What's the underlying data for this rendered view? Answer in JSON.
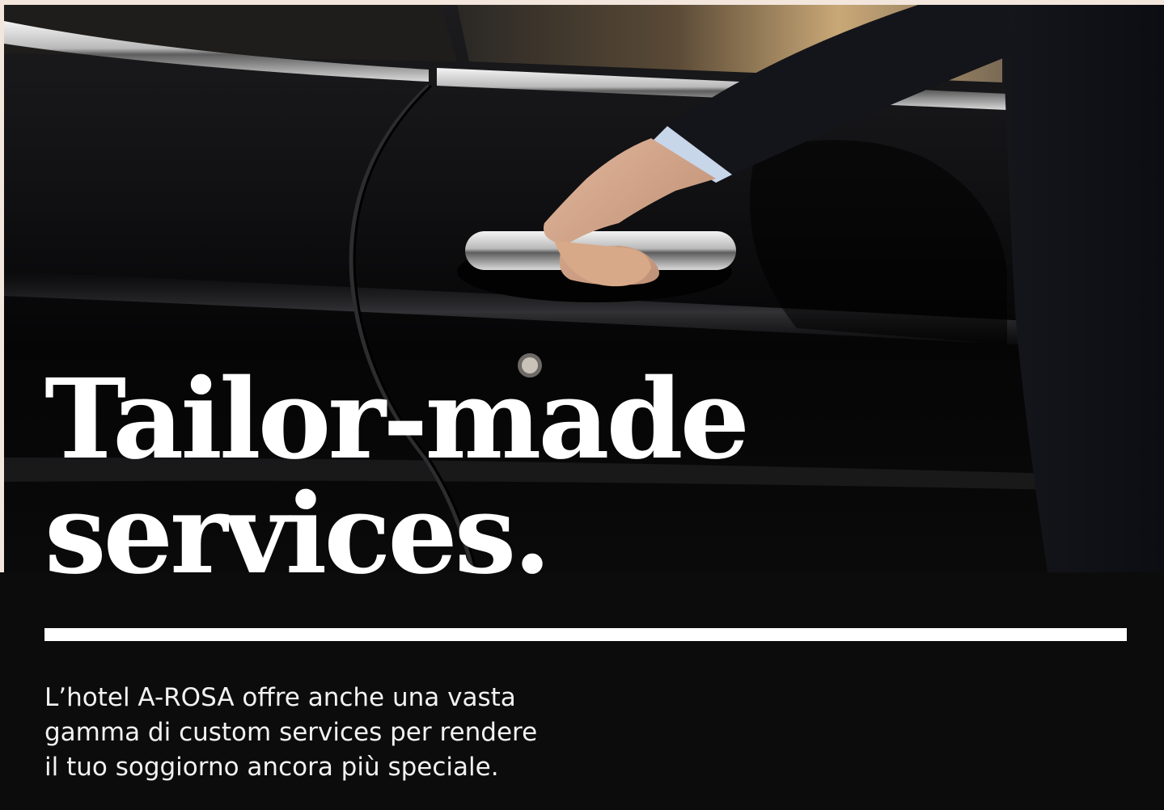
{
  "hero": {
    "image_name": "chauffeur-opening-car-door-photo",
    "headline_line1": "Tailor-made",
    "headline_line2": "services."
  },
  "content": {
    "description_line1": "L’hotel A-ROSA offre anche una vasta",
    "description_line2": "gamma di custom services per rendere",
    "description_line3": "il tuo soggiorno ancora più speciale."
  },
  "colors": {
    "background": "#0c0c0c",
    "frame": "#f2e6dd",
    "text": "#ffffff"
  }
}
